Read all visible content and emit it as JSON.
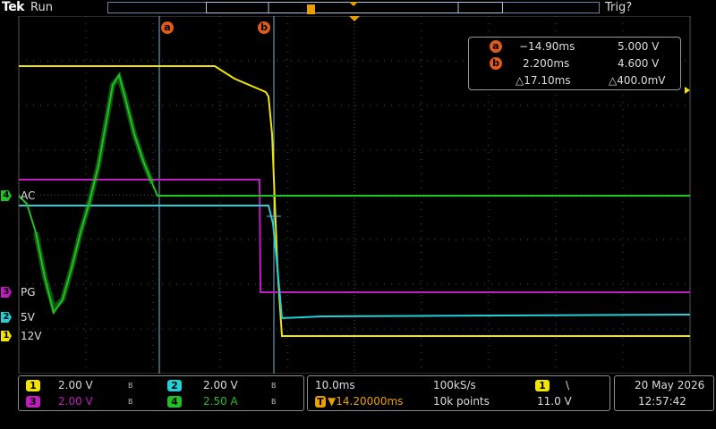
{
  "header": {
    "brand": "Tek",
    "run_state": "Run",
    "trigger_state": "Trig?",
    "trigger_marker": "T"
  },
  "cursors": {
    "a": {
      "id": "a",
      "time": "−14.90ms",
      "voltage": "5.000 V"
    },
    "b": {
      "id": "b",
      "time": "2.200ms",
      "voltage": "4.600 V"
    },
    "delta": {
      "time": "△17.10ms",
      "voltage": "△400.0mV"
    }
  },
  "channel_labels": {
    "ch4": {
      "number": "4",
      "label": "AC"
    },
    "ch3": {
      "number": "3",
      "label": "PG"
    },
    "ch2": {
      "number": "2",
      "label": "5V"
    },
    "ch1": {
      "number": "1",
      "label": "12V"
    }
  },
  "channels_panel": {
    "ch1": {
      "number": "1",
      "scale": "2.00 V",
      "bw": "B",
      "color": "#f2e600"
    },
    "ch2": {
      "number": "2",
      "scale": "2.00 V",
      "bw": "B",
      "color": "#22d0d8"
    },
    "ch3": {
      "number": "3",
      "scale": "2.00 V",
      "bw": "B",
      "color": "#c01cc0"
    },
    "ch4": {
      "number": "4",
      "scale": "2.50 A",
      "bw": "B",
      "color": "#22c022"
    }
  },
  "timebase": {
    "scale": "10.0ms",
    "sample_rate": "100kS/s",
    "trigger_offset": "▼14.20000ms",
    "record_length": "10k points"
  },
  "trigger": {
    "source": "1",
    "slope": "\\",
    "level": "11.0 V"
  },
  "datetime": {
    "date": "20 May 2026",
    "time": "12:57:42"
  },
  "colors": {
    "ch1": "#f2e600",
    "ch2": "#22d0d8",
    "ch3": "#c01cc0",
    "ch4": "#22c022",
    "cursor": "#e05a1a",
    "grid": "#555555"
  }
}
